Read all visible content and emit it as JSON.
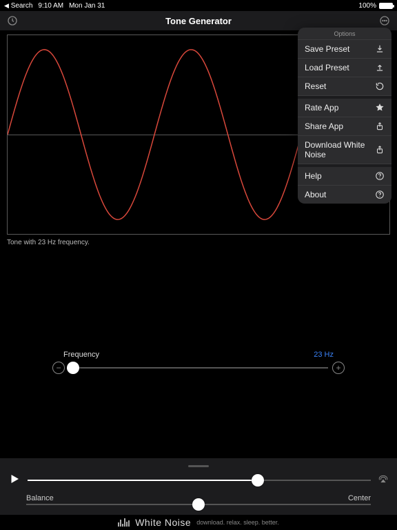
{
  "status": {
    "back": "Search",
    "time": "9:10 AM",
    "date": "Mon Jan 31",
    "battery": "100%"
  },
  "nav": {
    "title": "Tone Generator"
  },
  "wave": {
    "caption": "Tone with 23 Hz frequency."
  },
  "frequency": {
    "label": "Frequency",
    "value_text": "23 Hz",
    "value": 23,
    "min": 20,
    "max": 20000,
    "thumb_pct": 1.5
  },
  "volume": {
    "thumb_pct": 67
  },
  "balance": {
    "label": "Balance",
    "position_text": "Center",
    "thumb_pct": 50
  },
  "footer": {
    "brand": "White Noise",
    "tagline": "download. relax. sleep. better."
  },
  "options": {
    "header": "Options",
    "items": [
      {
        "label": "Save Preset",
        "icon": "download"
      },
      {
        "label": "Load Preset",
        "icon": "upload"
      },
      {
        "label": "Reset",
        "icon": "reset"
      },
      {
        "label": "Rate App",
        "icon": "star",
        "section": true
      },
      {
        "label": "Share App",
        "icon": "share"
      },
      {
        "label": "Download White Noise",
        "icon": "share"
      },
      {
        "label": "Help",
        "icon": "question",
        "section": true
      },
      {
        "label": "About",
        "icon": "question"
      }
    ]
  },
  "chart_data": {
    "type": "line",
    "title": "",
    "xlabel": "",
    "ylabel": "",
    "xlim": [
      0,
      556
    ],
    "ylim": [
      -1,
      1
    ],
    "series": [
      {
        "name": "tone",
        "frequency_hz": 23,
        "cycles_shown": 2.6,
        "amplitude": 0.9,
        "phase": 0
      }
    ]
  }
}
